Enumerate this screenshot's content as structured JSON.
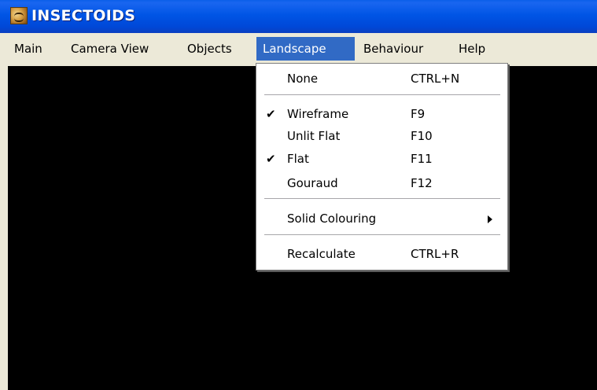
{
  "window": {
    "title": "INSECTOIDS"
  },
  "menubar": {
    "items": [
      {
        "label": "Main"
      },
      {
        "label": "Camera View"
      },
      {
        "label": "Objects"
      },
      {
        "label": "Landscape"
      },
      {
        "label": "Behaviour"
      },
      {
        "label": "Help"
      }
    ]
  },
  "landscape_menu": {
    "none": {
      "label": "None",
      "shortcut": "CTRL+N"
    },
    "wireframe": {
      "label": "Wireframe",
      "shortcut": "F9",
      "checked": true
    },
    "unlit_flat": {
      "label": "Unlit Flat",
      "shortcut": "F10",
      "checked": false
    },
    "flat": {
      "label": "Flat",
      "shortcut": "F11",
      "checked": true
    },
    "gouraud": {
      "label": "Gouraud",
      "shortcut": "F12",
      "checked": false
    },
    "solid_colouring": {
      "label": "Solid Colouring"
    },
    "recalculate": {
      "label": "Recalculate",
      "shortcut": "CTRL+R"
    },
    "check_glyph": "✔"
  }
}
